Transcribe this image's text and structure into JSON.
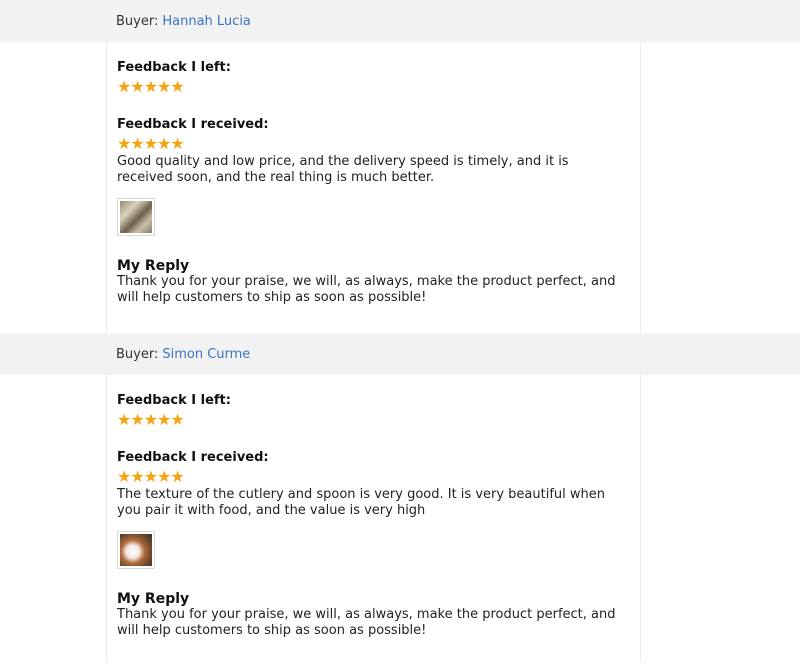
{
  "reviews": [
    {
      "buyer_label": "Buyer:",
      "buyer_name": "Hannah Lucia",
      "left_title": "Feedback I left:",
      "left_stars": "★★★★★",
      "left_rating": 5,
      "received_title": "Feedback I received:",
      "received_stars": "★★★★★",
      "received_rating": 5,
      "review_text": "Good quality and low price, and the delivery speed is timely, and it is received soon, and the real thing is much better.",
      "reply_title": "My Reply",
      "reply_text": "Thank you for your praise, we will, as always, make the product perfect, and will help customers to ship as soon as possible!"
    },
    {
      "buyer_label": "Buyer:",
      "buyer_name": "Simon Curme",
      "left_title": "Feedback I left:",
      "left_stars": "★★★★★",
      "left_rating": 5,
      "received_title": "Feedback I received:",
      "received_stars": "★★★★★",
      "received_rating": 5,
      "review_text": "The texture of the cutlery and spoon is very good. It is very beautiful when you pair it with food, and the value is very high",
      "reply_title": "My Reply",
      "reply_text": "Thank you for your praise, we will, as always, make the product perfect, and will help customers to ship as soon as possible!"
    }
  ],
  "colors": {
    "star": "#f5a313",
    "buyer_link": "#3a73c4",
    "header_bg": "#f2f2f2"
  },
  "icons": {
    "star": "star-icon",
    "thumbnail": "review-photo-thumbnail"
  }
}
